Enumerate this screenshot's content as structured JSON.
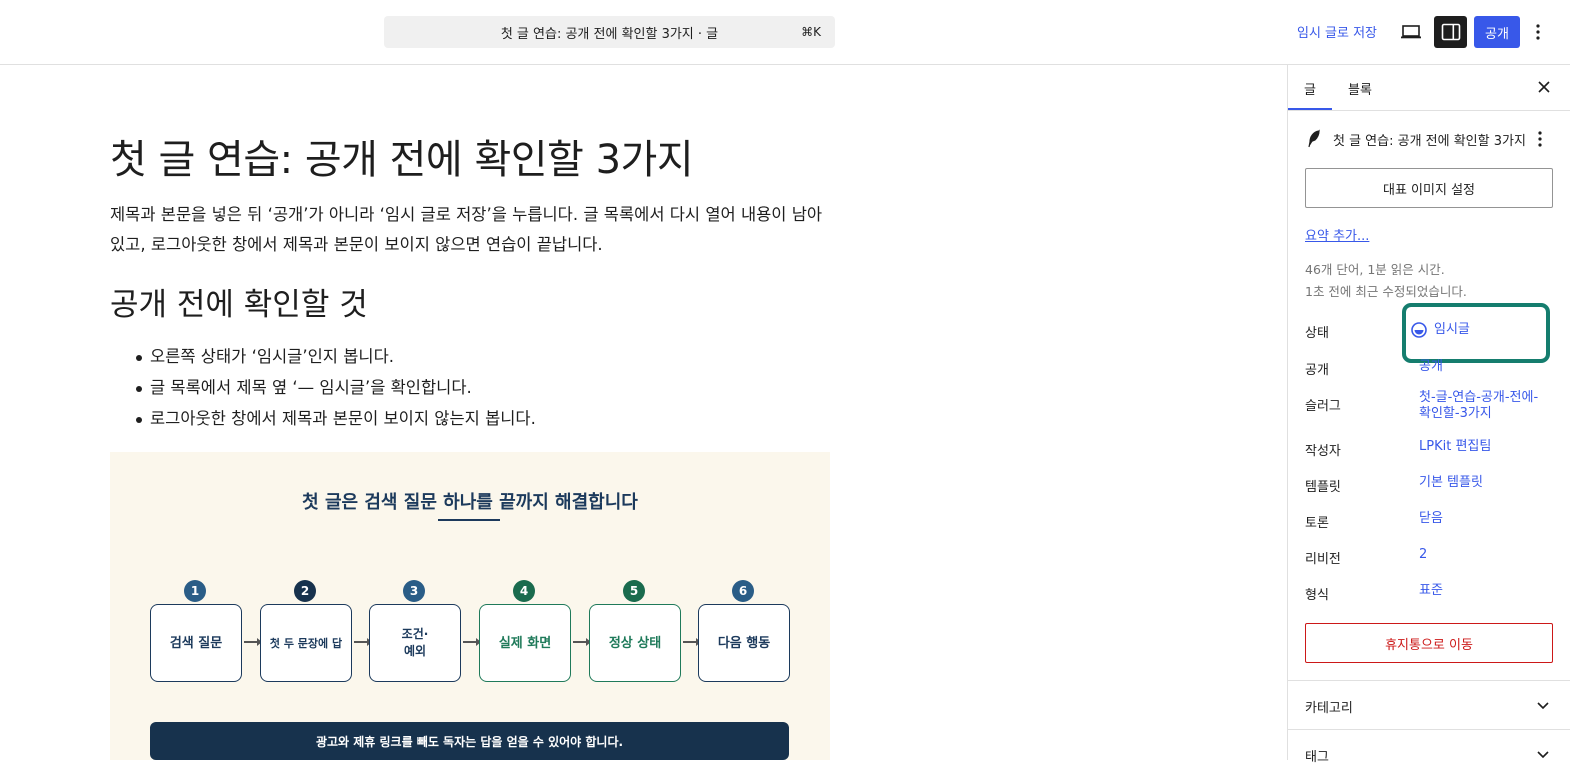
{
  "header": {
    "document_title": "첫 글 연습: 공개 전에 확인할 3가지 · 글",
    "shortcut": "⌘K",
    "save_draft_label": "임시 글로 저장",
    "publish_label": "공개",
    "preview_icon": "laptop-icon",
    "sidebar_icon": "sidebar-toggle-icon",
    "options_icon": "more-vertical-icon"
  },
  "content": {
    "title": "첫 글 연습: 공개 전에 확인할 3가지",
    "paragraph": "제목과 본문을 넣은 뒤 ‘공개’가 아니라 ‘임시 글로 저장’을 누릅니다. 글 목록에서 다시 열어 내용이 남아 있고, 로그아웃한 창에서 제목과 본문이 보이지 않으면 연습이 끝납니다.",
    "heading": "공개 전에 확인할 것",
    "bullets": [
      "오른쪽 상태가 ‘임시글’인지 봅니다.",
      "글 목록에서 제목 옆 ‘— 임시글’을 확인합니다.",
      "로그아웃한 창에서 제목과 본문이 보이지 않는지 봅니다."
    ],
    "image": {
      "title": "첫 글은 검색 질문 하나를 끝까지 해결합니다",
      "steps": [
        {
          "num": "1",
          "label": "검색 질문"
        },
        {
          "num": "2",
          "label": "첫 두 문장에 답"
        },
        {
          "num": "3",
          "label": "조건·\n예외"
        },
        {
          "num": "4",
          "label": "실제 화면"
        },
        {
          "num": "5",
          "label": "정상 상태"
        },
        {
          "num": "6",
          "label": "다음 행동"
        }
      ],
      "banner": "광고와 제휴 링크를 빼도 독자는 답을 얻을 수 있어야 합니다."
    }
  },
  "sidebar": {
    "tabs": [
      "글",
      "블록"
    ],
    "active_tab": "글",
    "post_title": "첫 글 연습: 공개 전에 확인할 3가지",
    "featured_image_label": "대표 이미지 설정",
    "excerpt_label": "요약 추가...",
    "word_count": "46개 단어, 1분 읽은 시간.",
    "last_edited": "1초 전에 최근 수정되었습니다.",
    "fields": {
      "status": {
        "label": "상태",
        "value": "임시글"
      },
      "visibility": {
        "label": "공개",
        "value": "공개"
      },
      "slug": {
        "label": "슬러그",
        "value_line1": "첫-글-연습-공개-전에-",
        "value_line2": "확인할-3가지"
      },
      "author": {
        "label": "작성자",
        "value": "LPKit 편집팀"
      },
      "template": {
        "label": "템플릿",
        "value": "기본 템플릿"
      },
      "discussion": {
        "label": "토론",
        "value": "닫음"
      },
      "revisions": {
        "label": "리비전",
        "value": "2"
      },
      "format": {
        "label": "형식",
        "value": "표준"
      }
    },
    "trash_label": "휴지통으로 이동",
    "panels": [
      "카테고리",
      "태그"
    ]
  },
  "colors": {
    "accent": "#3858e9",
    "highlight": "#157d6e",
    "danger": "#cc1818",
    "navy": "#1c3a5c",
    "green": "#1f7a5a"
  }
}
